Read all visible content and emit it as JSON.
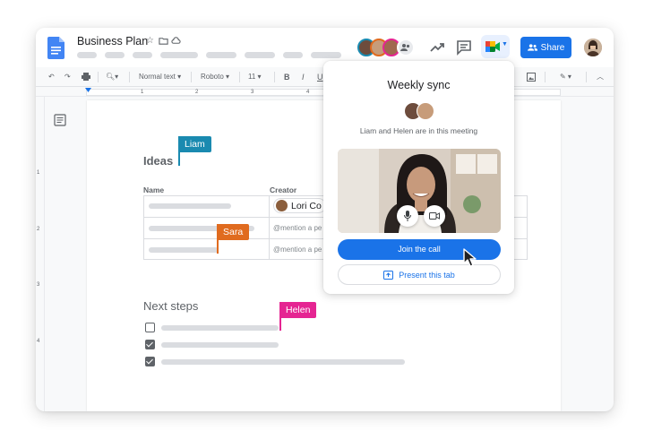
{
  "header": {
    "doc_title": "Business Plan",
    "share_label": "Share",
    "icons": [
      "docs-logo-icon",
      "star-icon",
      "move-folder-icon",
      "cloud-saved-icon",
      "trending-icon",
      "comment-icon",
      "meet-icon",
      "people-icon"
    ]
  },
  "toolbar": {
    "style": "Normal text",
    "font": "Roboto",
    "size": "11",
    "bold": "B",
    "italic": "I",
    "underline": "U",
    "zoom_icon": "zoom-icon"
  },
  "ruler": {
    "numbers": [
      "1",
      "2",
      "3",
      "4"
    ]
  },
  "vruler": {
    "numbers": [
      "1",
      "2",
      "3",
      "4"
    ]
  },
  "document": {
    "heading_ideas": "Ideas",
    "col_name": "Name",
    "col_creator": "Creator",
    "chip_name": "Lori Co",
    "mention_1": "@mention a pe",
    "mention_2": "@mention a pe",
    "heading_next": "Next steps",
    "checkboxes": [
      false,
      true,
      true
    ]
  },
  "cursors": {
    "liam": "Liam",
    "sara": "Sara",
    "helen": "Helen",
    "colors": {
      "liam": "#1a8ab0",
      "sara": "#e06b1f",
      "helen": "#e52592"
    }
  },
  "popup": {
    "title": "Weekly sync",
    "subtitle": "Liam and Helen are in this meeting",
    "join_label": "Join the call",
    "present_label": "Present this tab"
  },
  "colors": {
    "accent": "#1a73e8"
  }
}
